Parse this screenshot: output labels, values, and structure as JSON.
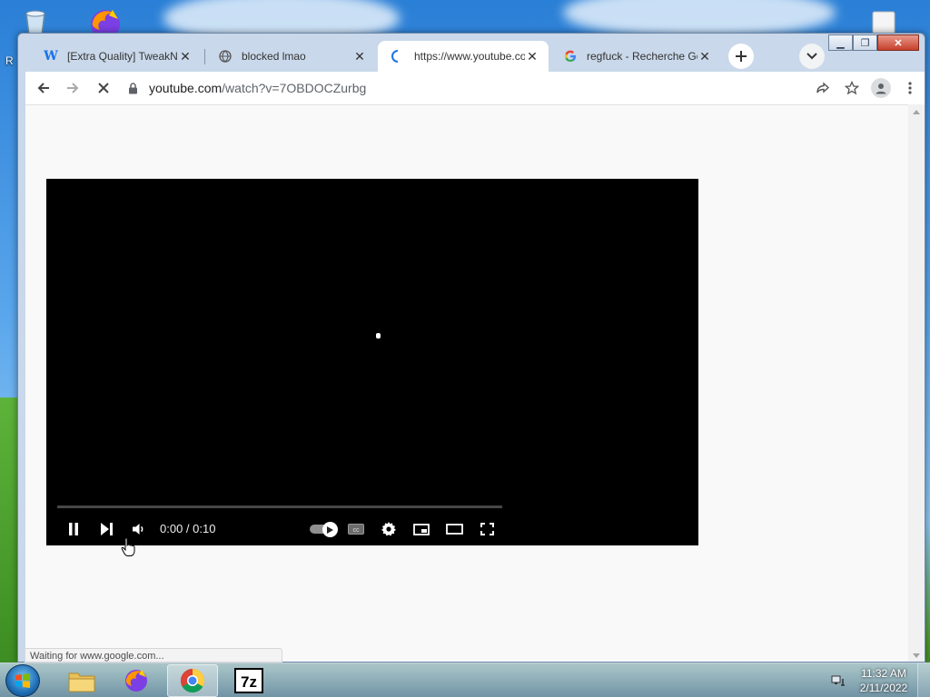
{
  "desktop": {
    "partial_label": "R"
  },
  "window_controls": {
    "minimize": "▁",
    "maximize": "❐",
    "close": "✕"
  },
  "tabs": [
    {
      "title": "[Extra Quality] TweakNT",
      "favicon": "W",
      "close": "✕"
    },
    {
      "title": "blocked lmao",
      "favicon": "globe-icon",
      "close": "✕"
    },
    {
      "title": "https://www.youtube.co",
      "favicon": "loading-icon",
      "close": "✕"
    },
    {
      "title": "regfuck - Recherche Go",
      "favicon": "google-icon",
      "close": "✕"
    }
  ],
  "toolbar": {
    "url_host": "youtube.com",
    "url_path": "/watch?v=7OBDOCZurbg"
  },
  "player": {
    "current_time": "0:00",
    "separator": " / ",
    "duration": "0:10",
    "progress": 0
  },
  "status_bar": {
    "text": "Waiting for www.google.com..."
  },
  "taskbar": {
    "items": [
      "explorer-icon",
      "firefox-icon",
      "chrome-icon",
      "7zip-icon"
    ],
    "sevenzip_label": "7z",
    "clock_time": "11:32 AM",
    "clock_date": "2/11/2022"
  },
  "colors": {
    "accent": "#1a73e8",
    "player_bg": "#000000",
    "page_bg": "#f9f9f9"
  }
}
